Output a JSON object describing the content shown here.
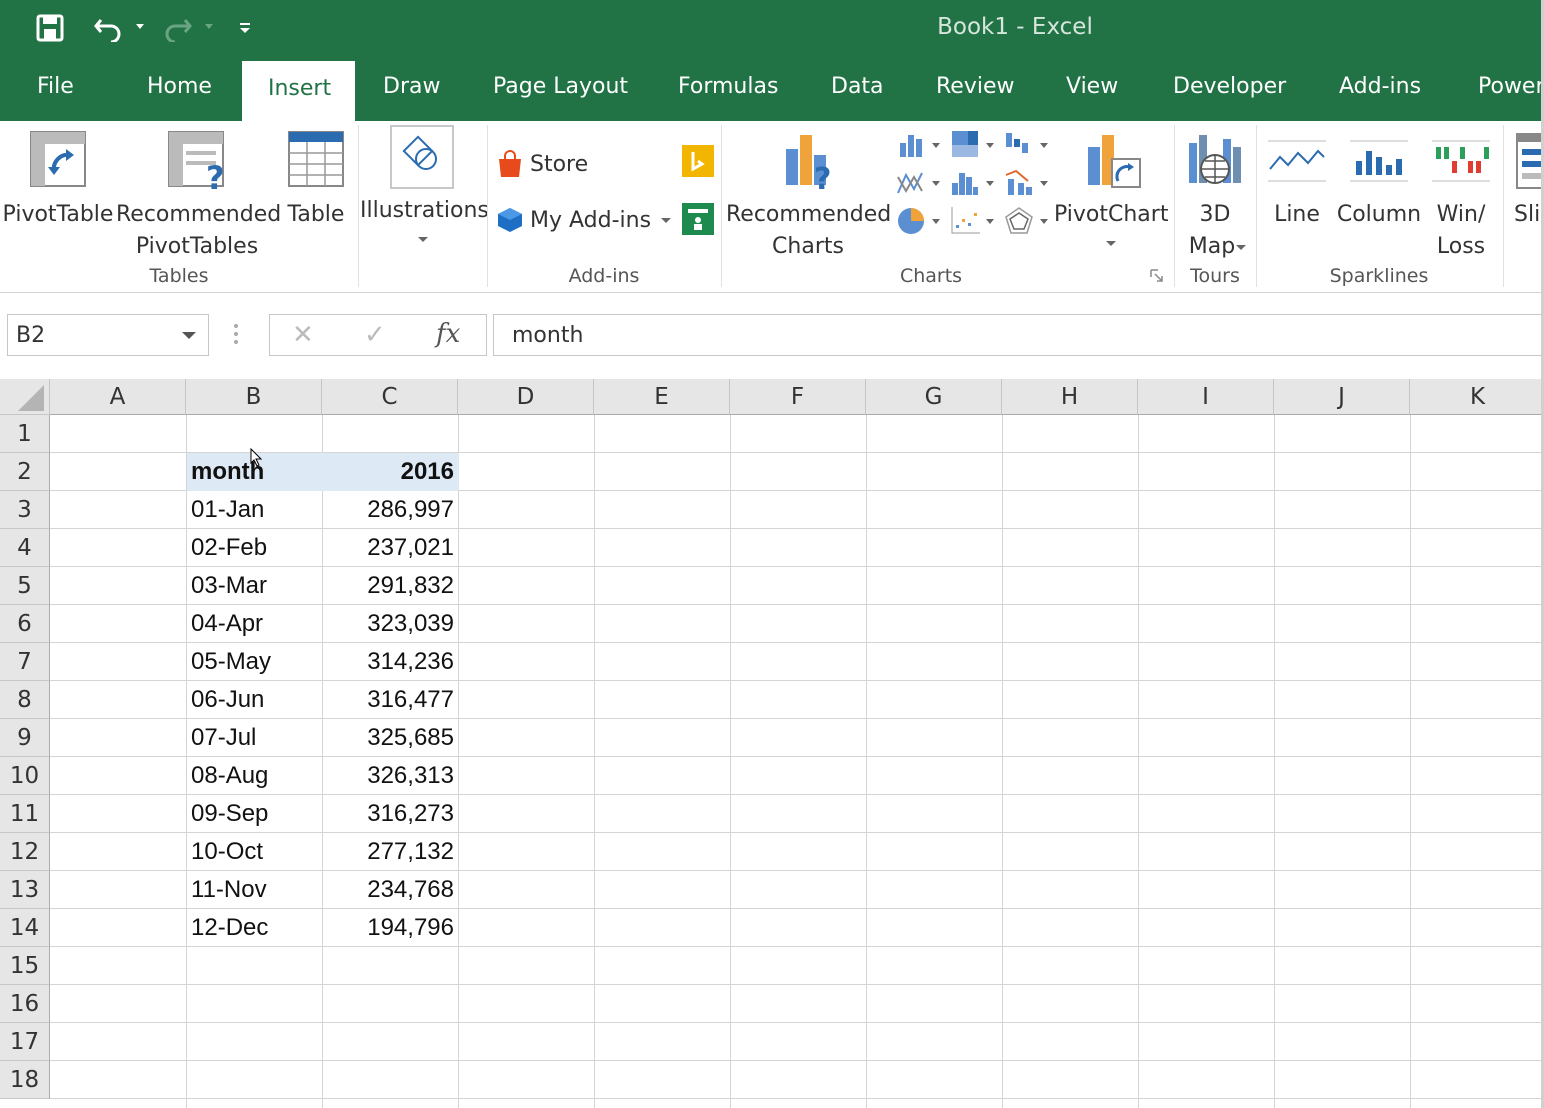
{
  "window": {
    "title": "Book1  -  Excel"
  },
  "qat": {
    "save": "save-icon",
    "undo": "undo-icon",
    "redo": "redo-icon",
    "customize": "customize-qat-icon"
  },
  "tabs": [
    {
      "label": "File"
    },
    {
      "label": "Home"
    },
    {
      "label": "Insert",
      "active": true
    },
    {
      "label": "Draw"
    },
    {
      "label": "Page Layout"
    },
    {
      "label": "Formulas"
    },
    {
      "label": "Data"
    },
    {
      "label": "Review"
    },
    {
      "label": "View"
    },
    {
      "label": "Developer"
    },
    {
      "label": "Add-ins"
    },
    {
      "label": "Power"
    }
  ],
  "ribbon": {
    "tables": {
      "label": "Tables",
      "pivottable": "PivotTable",
      "recommended_line1": "Recommended",
      "recommended_line2": "PivotTables",
      "table": "Table"
    },
    "illustrations": {
      "label": "Illustrations"
    },
    "addins": {
      "label": "Add-ins",
      "store": "Store",
      "my_addins": "My Add-ins"
    },
    "charts": {
      "label": "Charts",
      "recommended_line1": "Recommended",
      "recommended_line2": "Charts",
      "pivotchart": "PivotChart"
    },
    "tours": {
      "label": "Tours",
      "map_line1": "3D",
      "map_line2": "Map"
    },
    "sparklines": {
      "label": "Sparklines",
      "line": "Line",
      "column": "Column",
      "winloss_line1": "Win/",
      "winloss_line2": "Loss"
    },
    "slicer": {
      "label": "Sli"
    }
  },
  "formula_bar": {
    "name_box": "B2",
    "formula": "month",
    "cancel": "✕",
    "enter": "✓",
    "fx": "fx"
  },
  "sheet": {
    "columns": [
      "A",
      "B",
      "C",
      "D",
      "E",
      "F",
      "G",
      "H",
      "I",
      "J",
      "K"
    ],
    "rows": [
      "1",
      "2",
      "3",
      "4",
      "5",
      "6",
      "7",
      "8",
      "9",
      "10",
      "11",
      "12",
      "13",
      "14",
      "15",
      "16",
      "17",
      "18"
    ],
    "header": {
      "month": "month",
      "year": "2016"
    },
    "data": [
      {
        "month": "01-Jan",
        "value": "286,997"
      },
      {
        "month": "02-Feb",
        "value": "237,021"
      },
      {
        "month": "03-Mar",
        "value": "291,832"
      },
      {
        "month": "04-Apr",
        "value": "323,039"
      },
      {
        "month": "05-May",
        "value": "314,236"
      },
      {
        "month": "06-Jun",
        "value": "316,477"
      },
      {
        "month": "07-Jul",
        "value": "325,685"
      },
      {
        "month": "08-Aug",
        "value": "326,313"
      },
      {
        "month": "09-Sep",
        "value": "316,273"
      },
      {
        "month": "10-Oct",
        "value": "277,132"
      },
      {
        "month": "11-Nov",
        "value": "234,768"
      },
      {
        "month": "12-Dec",
        "value": "194,796"
      }
    ]
  },
  "colors": {
    "excel_green": "#217346",
    "selection_fill": "#dde9f5",
    "header_gray": "#e6e6e6",
    "grid_line": "#d4d4d4"
  }
}
